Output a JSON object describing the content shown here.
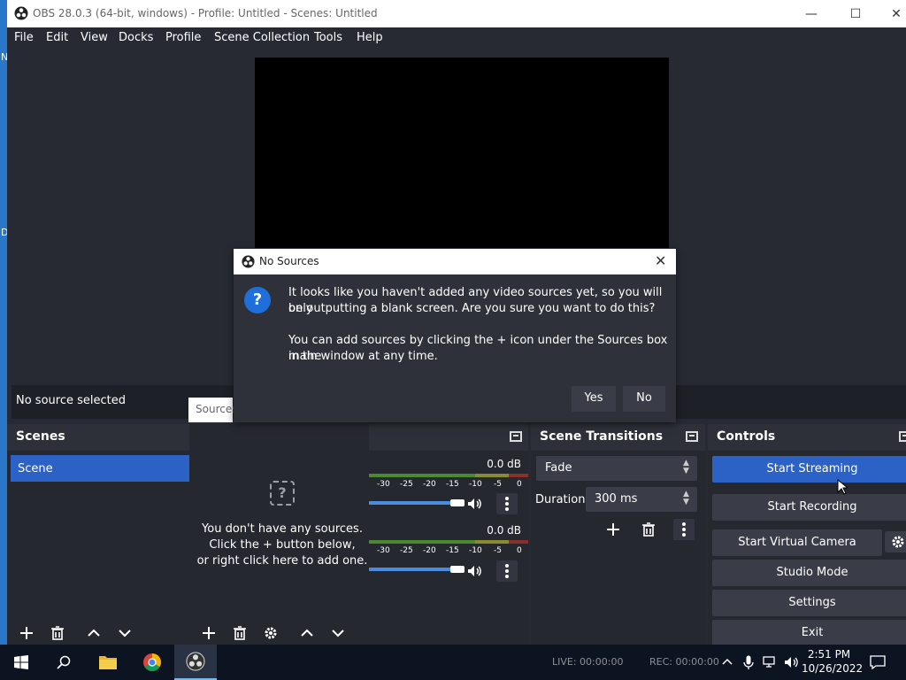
{
  "window": {
    "title": "OBS 28.0.3 (64-bit, windows) - Profile: Untitled - Scenes: Untitled",
    "minimize": "—",
    "maximize": "☐",
    "close": "✕"
  },
  "menu": [
    "File",
    "Edit",
    "View",
    "Docks",
    "Profile",
    "Scene Collection",
    "Tools",
    "Help"
  ],
  "source_bar": {
    "label": "No source selected",
    "tab": "Sources"
  },
  "scenes": {
    "title": "Scenes",
    "items": [
      "Scene"
    ]
  },
  "sources": {
    "empty_line1": "You don't have any sources.",
    "empty_line2": "Click the + button below,",
    "empty_line3": "or right click here to add one.",
    "help_glyph": "?"
  },
  "mixer": {
    "channels": [
      {
        "db": "0.0 dB",
        "volume": 1.0
      },
      {
        "db": "0.0 dB",
        "volume": 1.0
      }
    ],
    "scale": [
      "-30",
      "-25",
      "-20",
      "-15",
      "-10",
      "-5",
      "0"
    ]
  },
  "transitions": {
    "title": "Scene Transitions",
    "selected": "Fade",
    "duration_label": "Duration",
    "duration_value": "300 ms"
  },
  "controls": {
    "title": "Controls",
    "start_streaming": "Start Streaming",
    "start_recording": "Start Recording",
    "start_virtual_camera": "Start Virtual Camera",
    "studio_mode": "Studio Mode",
    "settings": "Settings",
    "exit": "Exit"
  },
  "dialog": {
    "title": "No Sources",
    "question_glyph": "?",
    "line1": "It looks like you haven't added any video sources yet, so you will only",
    "line2": "be outputting a blank screen. Are you sure you want to do this?",
    "line3": "You can add sources by clicking the + icon under the Sources box in the",
    "line4": "main window at any time.",
    "yes": "Yes",
    "no": "No"
  },
  "status": {
    "live": "LIVE: 00:00:00",
    "rec": "REC: 00:00:00"
  },
  "taskbar": {
    "time": "2:51 PM",
    "date": "10/26/2022"
  },
  "colors": {
    "accent": "#2c62c6",
    "window_bg": "#272a33",
    "dock_bg": "#262830"
  }
}
